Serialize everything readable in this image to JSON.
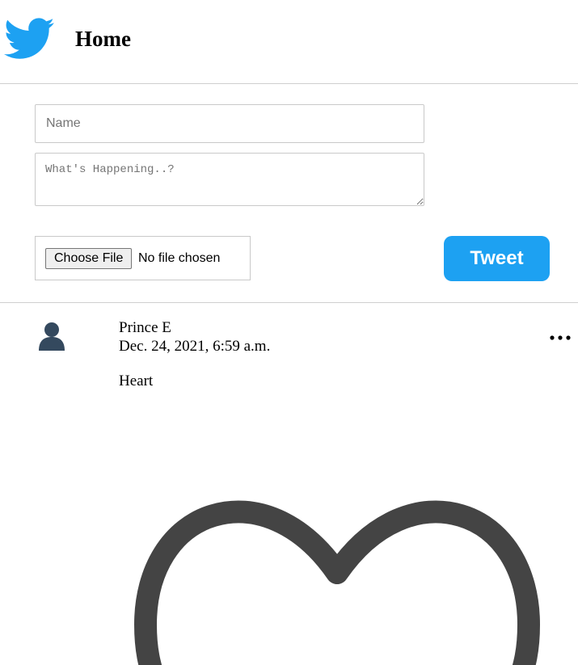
{
  "header": {
    "logo_icon": "twitter-bird-icon",
    "title": "Home"
  },
  "composer": {
    "name_placeholder": "Name",
    "text_placeholder": "What's Happening..?",
    "file_button_label": "Choose File",
    "file_status": "No file chosen",
    "tweet_button_label": "Tweet"
  },
  "tweets": [
    {
      "avatar_icon": "user-avatar-icon",
      "author": "Prince E",
      "timestamp": "Dec. 24, 2021, 6:59 a.m.",
      "text": "Heart",
      "image_icon": "heart-outline-icon",
      "menu_icon": "more-options-icon"
    }
  ],
  "colors": {
    "brand_blue": "#1da1f2",
    "avatar": "#34495e",
    "heart": "#444444",
    "divider": "#cfcfcf"
  }
}
